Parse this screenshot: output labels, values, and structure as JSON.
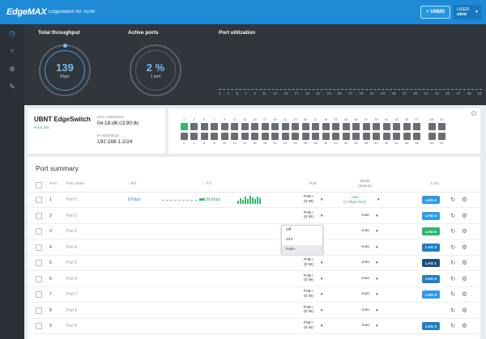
{
  "topbar": {
    "logo": "EdgeMAX",
    "device_title": "EdgeSwitch 48 750W",
    "unms_label": "+ UNMS",
    "user_label": "USER",
    "user_name": "ubnt"
  },
  "sidebar": {
    "items": [
      {
        "icon": "dashboard-icon",
        "active": true
      },
      {
        "icon": "ports-icon",
        "active": false
      },
      {
        "icon": "routing-globe-icon",
        "active": false
      },
      {
        "icon": "tools-wrench-icon",
        "active": false
      }
    ]
  },
  "stats": {
    "throughput_label": "Total throughput",
    "throughput_value": "139",
    "throughput_unit": "Kbps",
    "active_ports_label": "Active ports",
    "active_ports_value": "2 %",
    "active_ports_unit": "1 port",
    "utilization_label": "Port utilization",
    "utilization_axis": [
      "1",
      "3",
      "5",
      "7",
      "9",
      "11",
      "13",
      "15",
      "17",
      "19",
      "21",
      "23",
      "25",
      "27",
      "29",
      "31",
      "33",
      "35",
      "37",
      "39",
      "41",
      "43",
      "45",
      "47",
      "49",
      "51"
    ]
  },
  "device": {
    "name": "UBNT EdgeSwitch",
    "uptime": "● 4m 20s",
    "mac_label": "MAC ADDRESS",
    "mac_value": "04:18:d6:c3:90:8c",
    "ip_label": "IP ADDRESS",
    "ip_value": "192.168.1.2/24"
  },
  "portmap": {
    "top_numbers": [
      "1",
      "3",
      "5",
      "7",
      "9",
      "11",
      "13",
      "15",
      "17",
      "19",
      "21",
      "23",
      "25",
      "27",
      "29",
      "31",
      "33",
      "35",
      "37",
      "39",
      "41",
      "43",
      "45",
      "47",
      "49",
      "51"
    ],
    "bottom_numbers": [
      "2",
      "4",
      "6",
      "8",
      "10",
      "12",
      "14",
      "16",
      "18",
      "20",
      "22",
      "24",
      "26",
      "28",
      "30",
      "32",
      "34",
      "36",
      "38",
      "40",
      "42",
      "44",
      "46",
      "48",
      "50",
      "52"
    ],
    "active_port": "1",
    "info_icon": "i"
  },
  "summary": {
    "title": "Port summary",
    "headers": {
      "port": "Port",
      "port_name": "Port name",
      "rx": "↓ RX",
      "tx": "↑ TX",
      "poe": "PoE",
      "mode": "Mode",
      "mode_sub": "(Status)",
      "lag": "LAG"
    },
    "rows": [
      {
        "num": "1",
        "name": "Port 1",
        "rx": "8 Kbps",
        "tx": "139 Kbps",
        "poe_line1": "PoE+",
        "poe_line2": "(0 W)",
        "mode_line1": "Auto",
        "mode_line2": "(1 Gbps FDX)",
        "lag": "LAG 4",
        "lag_color": "#2e9be6"
      },
      {
        "num": "2",
        "name": "Port 2",
        "poe_line1": "PoE+",
        "poe_line2": "(0 W)",
        "mode": "Auto",
        "lag": "LAG 4",
        "lag_color": "#2e9be6"
      },
      {
        "num": "3",
        "name": "Port 3",
        "mode": "Auto",
        "lag": "LAG 5",
        "lag_color": "#2bb673"
      },
      {
        "num": "4",
        "name": "Port 4",
        "mode": "Auto",
        "lag": "LAG 3",
        "lag_color": "#1f7fc6"
      },
      {
        "num": "5",
        "name": "Port 5",
        "poe_line1": "PoE+",
        "poe_line2": "(0 W)",
        "mode": "Auto",
        "lag": "LAG 1",
        "lag_color": "#1b4f7a"
      },
      {
        "num": "6",
        "name": "Port 6",
        "poe_line1": "PoE+",
        "poe_line2": "(0 W)",
        "mode": "Auto",
        "lag": "LAG 3",
        "lag_color": "#1f7fc6"
      },
      {
        "num": "7",
        "name": "Port 7",
        "poe_line1": "PoE+",
        "poe_line2": "(0 W)",
        "mode": "Auto",
        "lag": "LAG 3",
        "lag_color": "#2e9be6"
      },
      {
        "num": "8",
        "name": "Port 8",
        "poe_line1": "PoE+",
        "poe_line2": "(0 W)",
        "mode": "Auto"
      },
      {
        "num": "9",
        "name": "Port 9",
        "poe_line1": "PoE+",
        "poe_line2": "(0 W)",
        "mode": "Auto",
        "lag": "LAG 3",
        "lag_color": "#1f7fc6"
      }
    ]
  },
  "dropdown": {
    "options": [
      "Off",
      "24V",
      "PoE+"
    ],
    "selected": "PoE+"
  }
}
